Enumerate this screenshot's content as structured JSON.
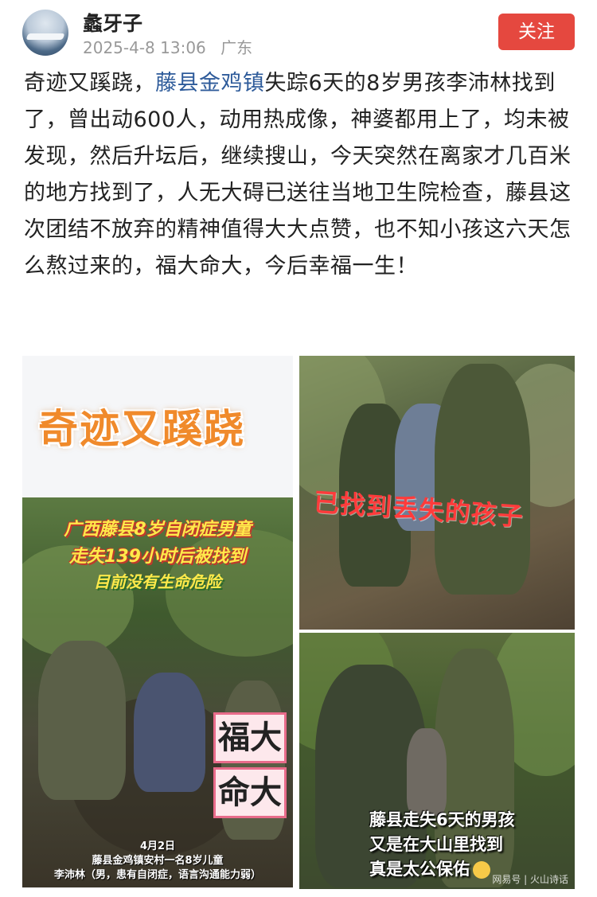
{
  "header": {
    "username": "蠡牙子",
    "datetime": "2025-4-8 13:06",
    "location": "广东",
    "follow_label": "关注",
    "avatar_icon": "avatar-icon"
  },
  "post": {
    "text_before_tag": "奇迹又蹊跷，",
    "tag": "藤县金鸡镇",
    "text_after_tag": "失踪6天的8岁男孩李沛林找到了，曾出动600人，动用热成像，神婆都用上了，均未被发现，然后升坛后，继续搜山，今天突然在离家才几百米的地方找到了，人无大碍已送往当地卫生院检查，藤县这次团结不放弃的精神值得大大点赞，也不知小孩这六天怎么熬过来的，福大命大，今后幸福一生！",
    "tag_color": "#2e5b9a"
  },
  "images": {
    "headline": "奇迹又蹊跷",
    "video": {
      "caption_line1": "广西藤县8岁自闭症男童",
      "caption_line2": "走失139小时后被找到",
      "caption_line3": "目前没有生命危险",
      "luck_line1": "福大",
      "luck_line2": "命大",
      "foot_line1": "4月2日",
      "foot_line2": "藤县金鸡镇安村一名8岁儿童",
      "foot_line3": "李沛林（男，患有自闭症，语言沟通能力弱）"
    },
    "photo_top": {
      "caption": "已找到丢失的孩子"
    },
    "photo_bottom": {
      "caption_line1": "藤县走失6天的男孩",
      "caption_line2": "又是在大山里找到",
      "caption_line3": "真是太公保佑",
      "watermark": "网易号 | 火山诗话"
    }
  },
  "colors": {
    "follow_button": "#e5483f",
    "headline": "#f08a2b"
  }
}
